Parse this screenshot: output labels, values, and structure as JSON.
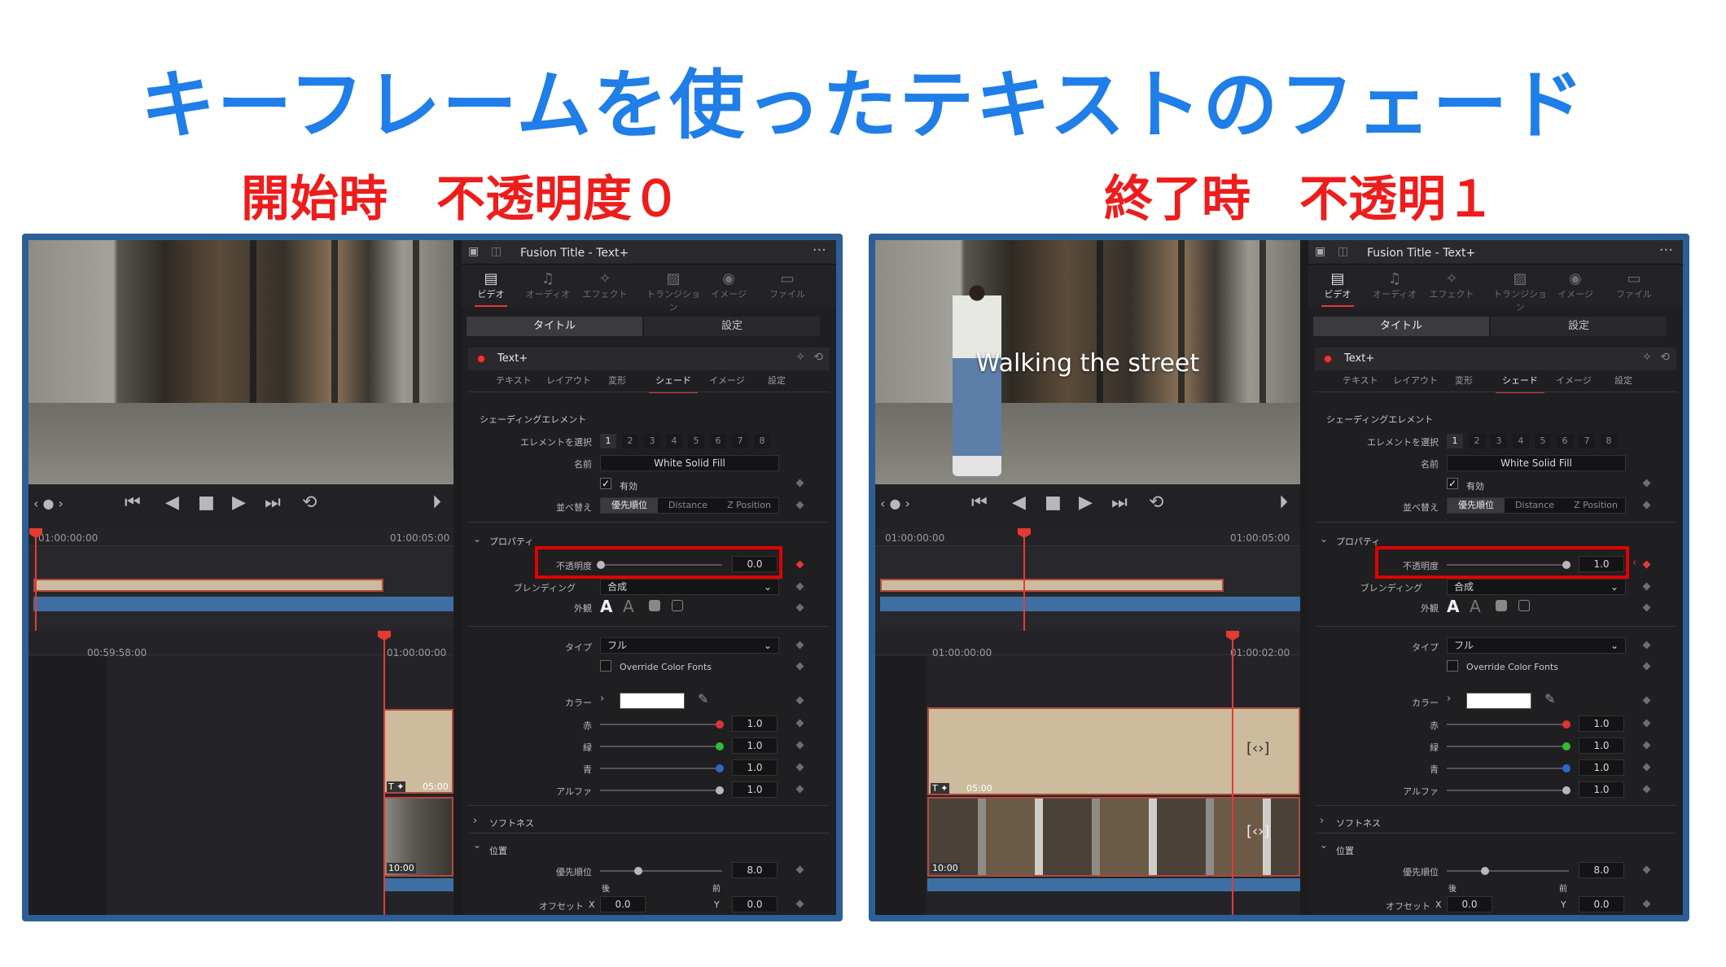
{
  "page": {
    "title": "キーフレームを使ったテキストのフェード",
    "left_label": "開始時　不透明度０",
    "right_label": "終了時　不透明１"
  },
  "colors": {
    "title": "#1f7ee8",
    "label": "#ef1c1c",
    "frame": "#2c5f96",
    "highlight": "#e20000",
    "accent": "#e43b31"
  },
  "panels": [
    {
      "viewer": {
        "caption": ""
      },
      "timeline": {
        "top_tc_start": "01:00:00:00",
        "top_tc_end": "01:00:05:00",
        "bottom_tc_left": "00:59:58:00",
        "bottom_tc_right": "01:00:00:00",
        "clip_title_dur": "05:00",
        "clip_video_dur": "10:00"
      },
      "inspector": {
        "header_title": "Fusion Title - Text+",
        "tabs": [
          "ビデオ",
          "オーディオ",
          "エフェクト",
          "トランジション",
          "イメージ",
          "ファイル"
        ],
        "seg_left": "タイトル",
        "seg_right": "設定",
        "section_title": "Text+",
        "subtabs": [
          "テキスト",
          "レイアウト",
          "変形",
          "シェード",
          "イメージ",
          "設定"
        ],
        "shading_label": "シェーディングエレメント",
        "element_select_label": "エレメントを選択",
        "elements": [
          "1",
          "2",
          "3",
          "4",
          "5",
          "6",
          "7",
          "8"
        ],
        "name_label": "名前",
        "name_value": "White Solid Fill",
        "enabled_label": "有効",
        "sort_label": "並べ替え",
        "sort_options": [
          "優先順位",
          "Distance",
          "Z Position"
        ],
        "properties_label": "プロパティ",
        "opacity_label": "不透明度",
        "opacity_value": "0.0",
        "blending_label": "ブレンディング",
        "blending_value": "合成",
        "appearance_label": "外観",
        "type_label": "タイプ",
        "type_value": "フル",
        "override_label": "Override Color Fonts",
        "color_label": "カラー",
        "red_label": "赤",
        "red_value": "1.0",
        "green_label": "緑",
        "green_value": "1.0",
        "blue_label": "青",
        "blue_value": "1.0",
        "alpha_label": "アルファ",
        "alpha_value": "1.0",
        "softness_label": "ソフトネス",
        "position_label": "位置",
        "priority_label": "優先順位",
        "priority_value": "8.0",
        "back_label": "後",
        "front_label": "前",
        "offset_label": "オフセット",
        "x_label": "X",
        "x_value": "0.0",
        "y_label": "Y",
        "y_value": "0.0"
      }
    },
    {
      "viewer": {
        "caption": "Walking the street"
      },
      "timeline": {
        "top_tc_start": "01:00:00:00",
        "top_tc_end": "01:00:05:00",
        "bottom_tc_left": "01:00:00:00",
        "bottom_tc_right": "01:00:02:00",
        "clip_title_dur": "05:00",
        "clip_video_dur": "10:00"
      },
      "inspector": {
        "header_title": "Fusion Title - Text+",
        "tabs": [
          "ビデオ",
          "オーディオ",
          "エフェクト",
          "トランジション",
          "イメージ",
          "ファイル"
        ],
        "seg_left": "タイトル",
        "seg_right": "設定",
        "section_title": "Text+",
        "subtabs": [
          "テキスト",
          "レイアウト",
          "変形",
          "シェード",
          "イメージ",
          "設定"
        ],
        "shading_label": "シェーディングエレメント",
        "element_select_label": "エレメントを選択",
        "elements": [
          "1",
          "2",
          "3",
          "4",
          "5",
          "6",
          "7",
          "8"
        ],
        "name_label": "名前",
        "name_value": "White Solid Fill",
        "enabled_label": "有効",
        "sort_label": "並べ替え",
        "sort_options": [
          "優先順位",
          "Distance",
          "Z Position"
        ],
        "properties_label": "プロパティ",
        "opacity_label": "不透明度",
        "opacity_value": "1.0",
        "blending_label": "ブレンディング",
        "blending_value": "合成",
        "appearance_label": "外観",
        "type_label": "タイプ",
        "type_value": "フル",
        "override_label": "Override Color Fonts",
        "color_label": "カラー",
        "red_label": "赤",
        "red_value": "1.0",
        "green_label": "緑",
        "green_value": "1.0",
        "blue_label": "青",
        "blue_value": "1.0",
        "alpha_label": "アルファ",
        "alpha_value": "1.0",
        "softness_label": "ソフトネス",
        "position_label": "位置",
        "priority_label": "優先順位",
        "priority_value": "8.0",
        "back_label": "後",
        "front_label": "前",
        "offset_label": "オフセット",
        "x_label": "X",
        "x_value": "0.0",
        "y_label": "Y",
        "y_value": "0.0"
      }
    }
  ]
}
